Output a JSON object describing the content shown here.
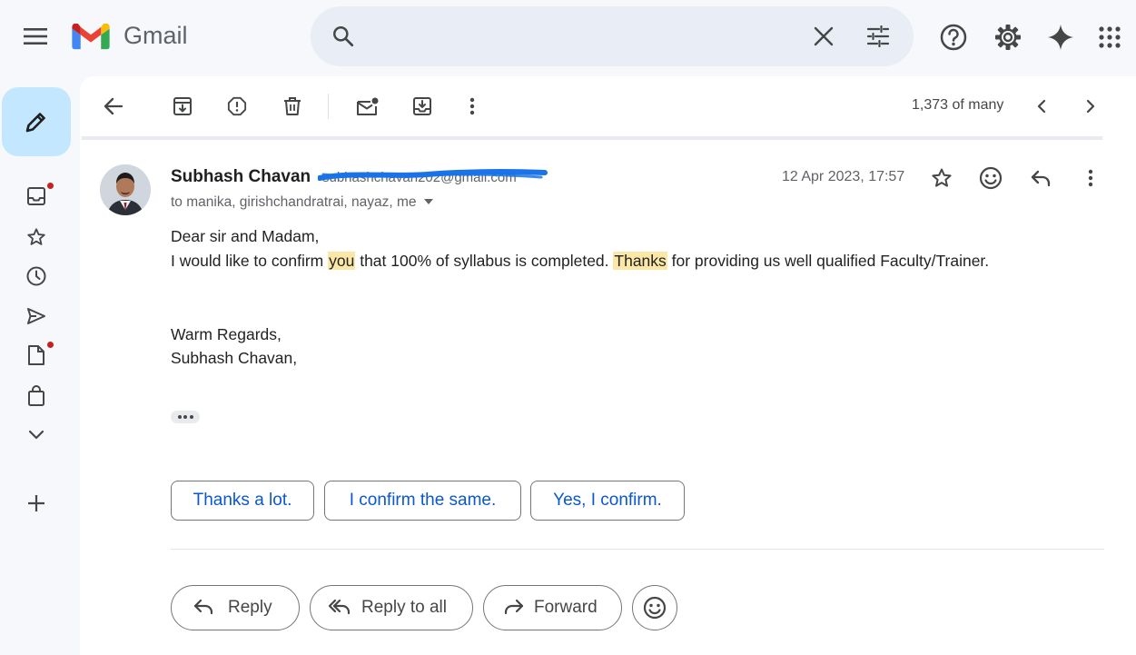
{
  "app": {
    "brand": "Gmail"
  },
  "toolbar": {
    "pager": "1,373 of many"
  },
  "message": {
    "sender_name": "Subhash Chavan",
    "sender_email": "subhashchavan202@gmail.com",
    "to_line": "to manika, girishchandratrai, nayaz, me",
    "date": "12 Apr 2023, 17:57",
    "body": {
      "greeting": "Dear sir and Madam,",
      "line1_a": "I would like to confirm ",
      "line1_hl1": "you",
      "line1_b": " that 100% of syllabus is completed. ",
      "line1_hl2": "Thanks",
      "line1_c": " for providing us well qualified Faculty/Trainer.",
      "regards": "Warm Regards,",
      "signature": "Subhash Chavan,"
    }
  },
  "smart_replies": [
    "Thanks a lot.",
    "I confirm the same.",
    "Yes, I confirm."
  ],
  "actions": {
    "reply": "Reply",
    "reply_all": "Reply to all",
    "forward": "Forward"
  },
  "icons": {
    "menu": "menu-icon",
    "search": "search-icon",
    "clear": "close-icon",
    "filters": "tune-icon",
    "help": "help-icon",
    "settings": "gear-icon",
    "gemini": "sparkle-icon",
    "apps": "apps-grid-icon",
    "compose": "pencil-icon",
    "inbox": "inbox-icon",
    "starred": "star-icon",
    "snoozed": "clock-icon",
    "sent": "send-icon",
    "drafts": "draft-icon",
    "purchases": "shopping-bag-icon",
    "more": "chevron-down-icon",
    "new_label": "plus-icon"
  },
  "colors": {
    "accent": "#0b57d0",
    "highlight": "#fce8a6",
    "notify_dot": "#c5221f",
    "compose_bg": "#c2e7ff",
    "redaction": "#1a73e8"
  }
}
